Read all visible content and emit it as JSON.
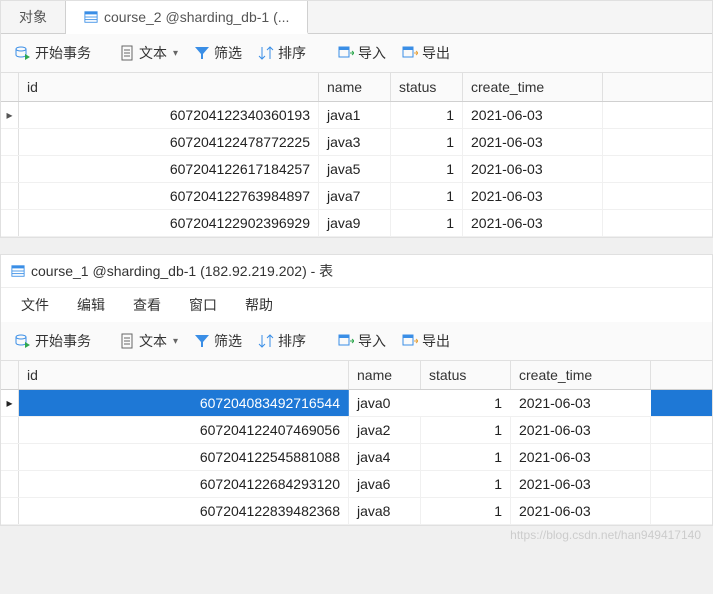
{
  "top": {
    "tabs": [
      {
        "label": "对象"
      },
      {
        "label": "course_2 @sharding_db-1 (...",
        "icon": "table"
      }
    ],
    "toolbar": {
      "begin": "开始事务",
      "text": "文本",
      "filter": "筛选",
      "sort": "排序",
      "import": "导入",
      "export": "导出"
    },
    "columns": [
      "id",
      "name",
      "status",
      "create_time"
    ],
    "rows": [
      {
        "id": "607204122340360193",
        "name": "java1",
        "status": "1",
        "ct": "2021-06-03"
      },
      {
        "id": "607204122478772225",
        "name": "java3",
        "status": "1",
        "ct": "2021-06-03"
      },
      {
        "id": "607204122617184257",
        "name": "java5",
        "status": "1",
        "ct": "2021-06-03"
      },
      {
        "id": "607204122763984897",
        "name": "java7",
        "status": "1",
        "ct": "2021-06-03"
      },
      {
        "id": "607204122902396929",
        "name": "java9",
        "status": "1",
        "ct": "2021-06-03"
      }
    ]
  },
  "bottom": {
    "title": "course_1 @sharding_db-1 (182.92.219.202) - 表",
    "menu": [
      "文件",
      "编辑",
      "查看",
      "窗口",
      "帮助"
    ],
    "toolbar": {
      "begin": "开始事务",
      "text": "文本",
      "filter": "筛选",
      "sort": "排序",
      "import": "导入",
      "export": "导出"
    },
    "columns": [
      "id",
      "name",
      "status",
      "create_time"
    ],
    "rows": [
      {
        "id": "607204083492716544",
        "name": "java0",
        "status": "1",
        "ct": "2021-06-03"
      },
      {
        "id": "607204122407469056",
        "name": "java2",
        "status": "1",
        "ct": "2021-06-03"
      },
      {
        "id": "607204122545881088",
        "name": "java4",
        "status": "1",
        "ct": "2021-06-03"
      },
      {
        "id": "607204122684293120",
        "name": "java6",
        "status": "1",
        "ct": "2021-06-03"
      },
      {
        "id": "607204122839482368",
        "name": "java8",
        "status": "1",
        "ct": "2021-06-03"
      }
    ]
  },
  "watermark": "https://blog.csdn.net/han949417140"
}
